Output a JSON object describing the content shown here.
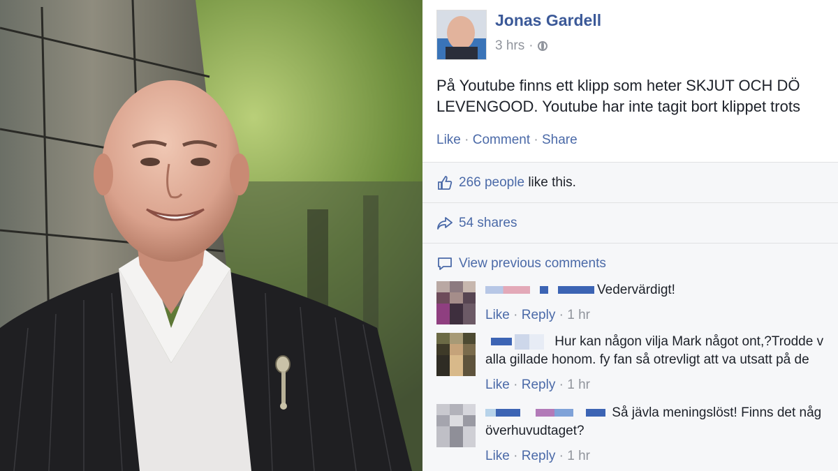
{
  "post": {
    "author": "Jonas Gardell",
    "time": "3 hrs",
    "dot": "·",
    "text_line1": "På Youtube finns ett klipp som heter SKJUT OCH DÖ",
    "text_line2": "LEVENGOOD. Youtube har inte tagit bort klippet trots",
    "like": "Like",
    "comment": "Comment",
    "share": "Share",
    "sep": "·"
  },
  "ufi": {
    "likes_link": "266 people",
    "likes_rest": " like this.",
    "shares": "54 shares",
    "view_previous": "View previous comments"
  },
  "comments": [
    {
      "text_line1": "Vedervärdigt!",
      "text_line2": "",
      "like": "Like",
      "reply": "Reply",
      "time": "1 hr"
    },
    {
      "text_line1": "Hur kan någon vilja Mark något ont,?Trodde v",
      "text_line2": "alla gillade honom. fy fan så otrevligt att va utsatt på de",
      "like": "Like",
      "reply": "Reply",
      "time": "1 hr"
    },
    {
      "text_line1": "Så jävla meningslöst! Finns det någ",
      "text_line2": "överhuvudtaget?",
      "like": "Like",
      "reply": "Reply",
      "time": "1 hr"
    }
  ],
  "icons": {
    "globe": "globe-icon",
    "like": "thumbs-up-icon",
    "share": "share-arrow-icon",
    "comment": "comment-bubble-icon"
  },
  "colors": {
    "link": "#4b6aa8",
    "author": "#3b5998",
    "muted": "#90949c",
    "ufi_bg": "#f6f7f9"
  }
}
